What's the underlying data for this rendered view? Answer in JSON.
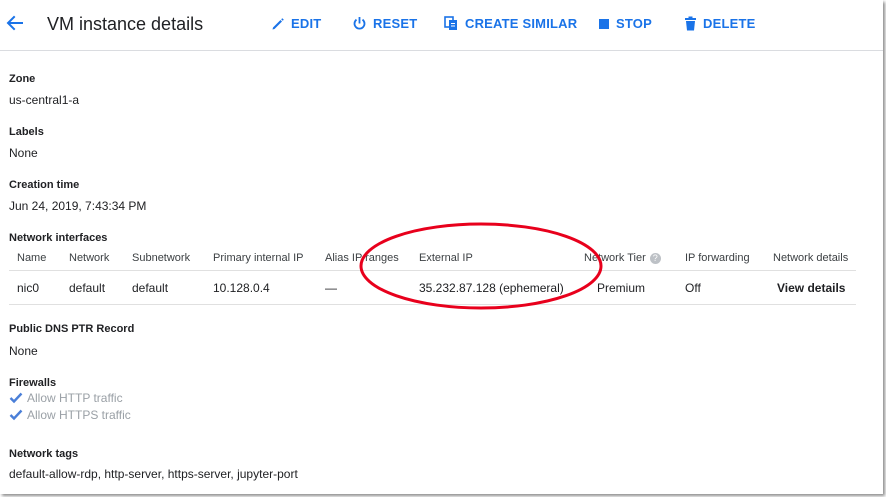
{
  "header": {
    "title": "VM instance details",
    "actions": {
      "edit": "EDIT",
      "reset": "RESET",
      "create_similar": "CREATE SIMILAR",
      "stop": "STOP",
      "delete": "DELETE"
    }
  },
  "details": {
    "zone_label": "Zone",
    "zone_value": "us-central1-a",
    "labels_label": "Labels",
    "labels_value": "None",
    "creation_label": "Creation time",
    "creation_value": "Jun 24, 2019, 7:43:34 PM",
    "network_interfaces_label": "Network interfaces",
    "dns_label": "Public DNS PTR Record",
    "dns_value": "None",
    "firewalls_label": "Firewalls",
    "firewalls": [
      {
        "label": "Allow HTTP traffic",
        "checked": true
      },
      {
        "label": "Allow HTTPS traffic",
        "checked": true
      }
    ],
    "tags_label": "Network tags",
    "tags_value": "default-allow-rdp, http-server, https-server, jupyter-port"
  },
  "network_table": {
    "headers": [
      "Name",
      "Network",
      "Subnetwork",
      "Primary internal IP",
      "Alias IP ranges",
      "External IP",
      "Network Tier",
      "IP forwarding",
      "Network details"
    ],
    "row": [
      "nic0",
      "default",
      "default",
      "10.128.0.4",
      "—",
      "35.232.87.128 (ephemeral)",
      "Premium",
      "Off",
      "View details"
    ]
  },
  "colors": {
    "accent": "#1a73e8",
    "annotation": "#e8001c"
  }
}
